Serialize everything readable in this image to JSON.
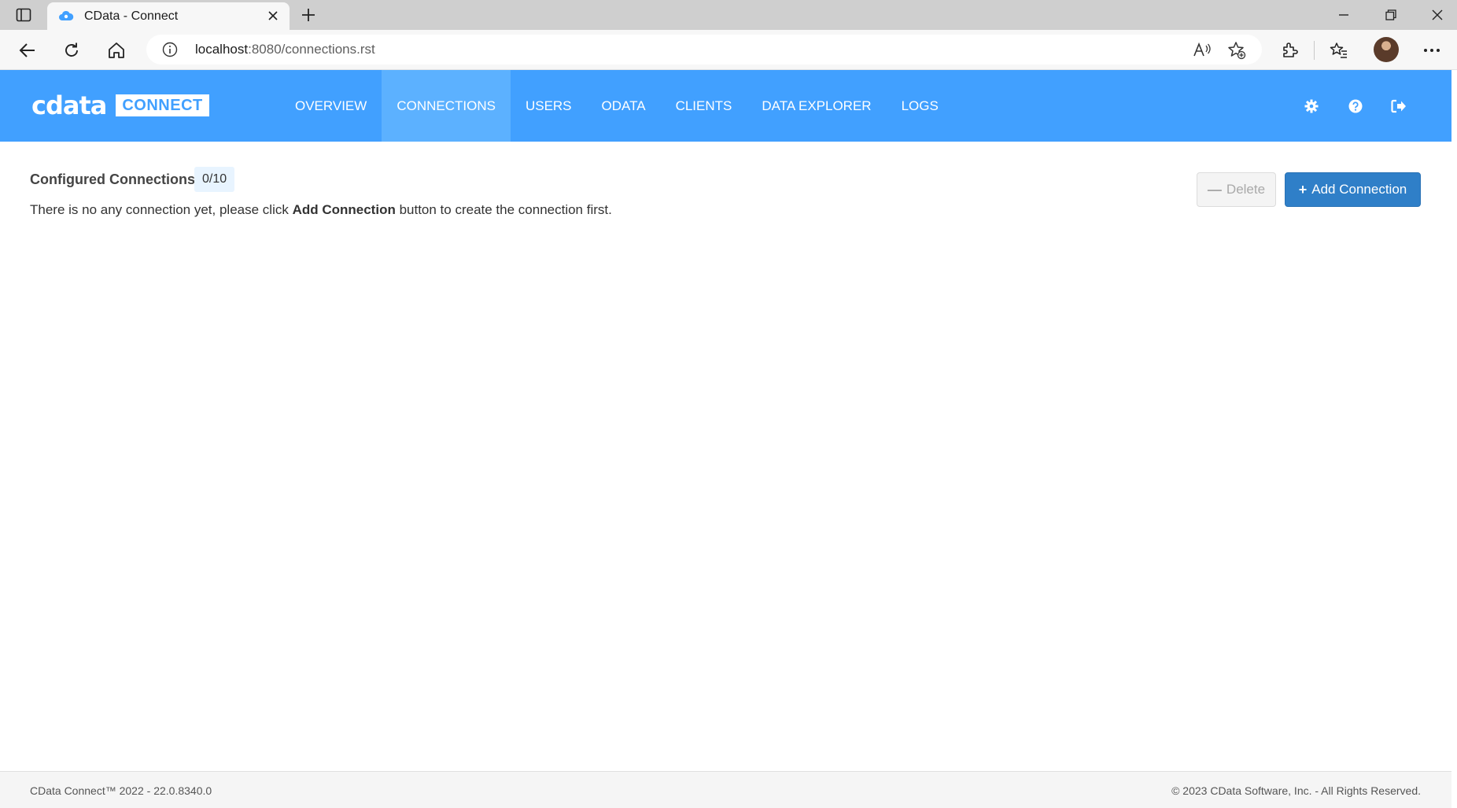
{
  "browser": {
    "tab_title": "CData - Connect",
    "url_host": "localhost",
    "url_rest": ":8080/connections.rst"
  },
  "app": {
    "logo_text": "cdata",
    "logo_badge": "CONNECT",
    "nav": [
      {
        "label": "OVERVIEW"
      },
      {
        "label": "CONNECTIONS",
        "active": true
      },
      {
        "label": "USERS"
      },
      {
        "label": "ODATA"
      },
      {
        "label": "CLIENTS"
      },
      {
        "label": "DATA EXPLORER"
      },
      {
        "label": "LOGS"
      }
    ],
    "header_icons": [
      "gear-icon",
      "help-icon",
      "logout-icon"
    ]
  },
  "connections": {
    "label": "Configured Connections:",
    "count": "0/10",
    "empty_prefix": "There is no any connection yet, please click ",
    "empty_bold": "Add Connection",
    "empty_suffix": " button to create the connection first.",
    "delete_label": "Delete",
    "add_label": "Add Connection"
  },
  "footer": {
    "left": "CData Connect™ 2022 - 22.0.8340.0",
    "right": "© 2023 CData Software, Inc. - All Rights Reserved."
  },
  "colors": {
    "header_bg": "#41a0ff",
    "nav_active_bg": "#5cb1ff",
    "primary_button": "#2f7fc8"
  }
}
